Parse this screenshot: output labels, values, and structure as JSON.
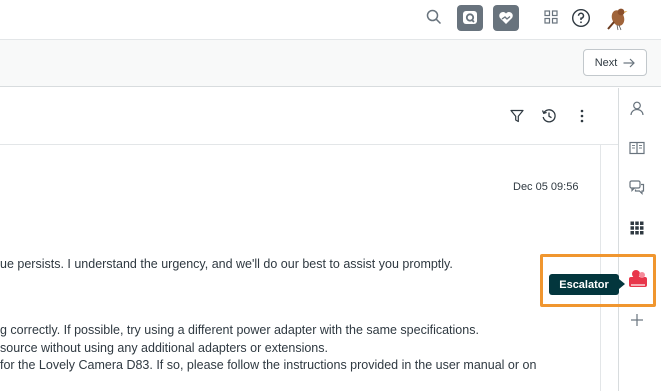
{
  "topbar": {
    "icons": [
      "search-icon",
      "app-icon-q",
      "app-icon-heart",
      "grid-icon",
      "help-icon",
      "avatar-bird"
    ]
  },
  "toolbar": {
    "next_label": "Next"
  },
  "main": {
    "timestamp": "Dec 05 09:56",
    "lines": [
      "ue persists. I understand the urgency, and we'll do our best to assist you promptly.",
      "g correctly. If possible, try using a different power adapter with the same specifications.",
      "source without using any additional adapters or extensions.",
      " for the Lovely Camera D83. If so, please follow the instructions provided in the user manual or on"
    ]
  },
  "sidebar": {
    "tooltip": "Escalator",
    "icons": [
      "user-icon",
      "book-icon",
      "chat-icon",
      "apps-icon",
      "escalator-icon",
      "add-icon"
    ]
  },
  "colors": {
    "highlight": "#f0962f",
    "tooltip_bg": "#03363d",
    "app_button": "#68737d",
    "escalator": "#e8364a"
  }
}
